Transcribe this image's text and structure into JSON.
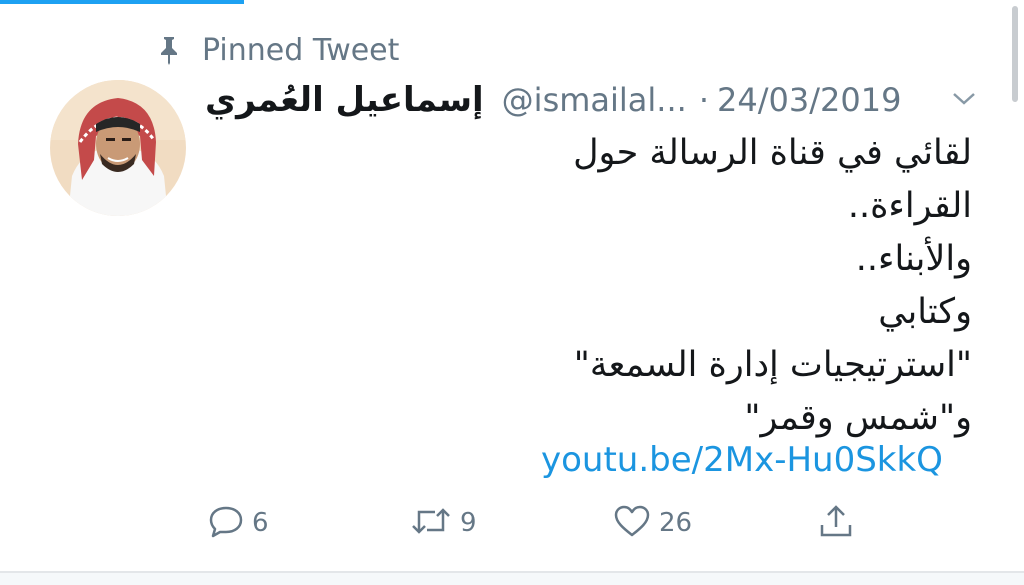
{
  "pinned": {
    "label": "Pinned Tweet"
  },
  "user": {
    "display_name": "إسماعيل العُمري",
    "handle": "@ismailal...",
    "date": "24/03/2019"
  },
  "tweet": {
    "lines": [
      "لقائي في قناة الرسالة حول",
      "القراءة..",
      "والأبناء..",
      "وكتابي",
      "\"استرتيجيات إدارة السمعة\"",
      "و\"شمس وقمر\""
    ],
    "link": "youtu.be/2Mx-Hu0SkkQ"
  },
  "actions": {
    "reply_count": "6",
    "retweet_count": "9",
    "like_count": "26"
  },
  "colors": {
    "accent": "#1da1f2",
    "link": "#1b95e0",
    "muted": "#657786",
    "text": "#14171a"
  },
  "icons": [
    "pin-icon",
    "chevron-down-icon",
    "reply-icon",
    "retweet-icon",
    "like-icon",
    "share-icon"
  ]
}
